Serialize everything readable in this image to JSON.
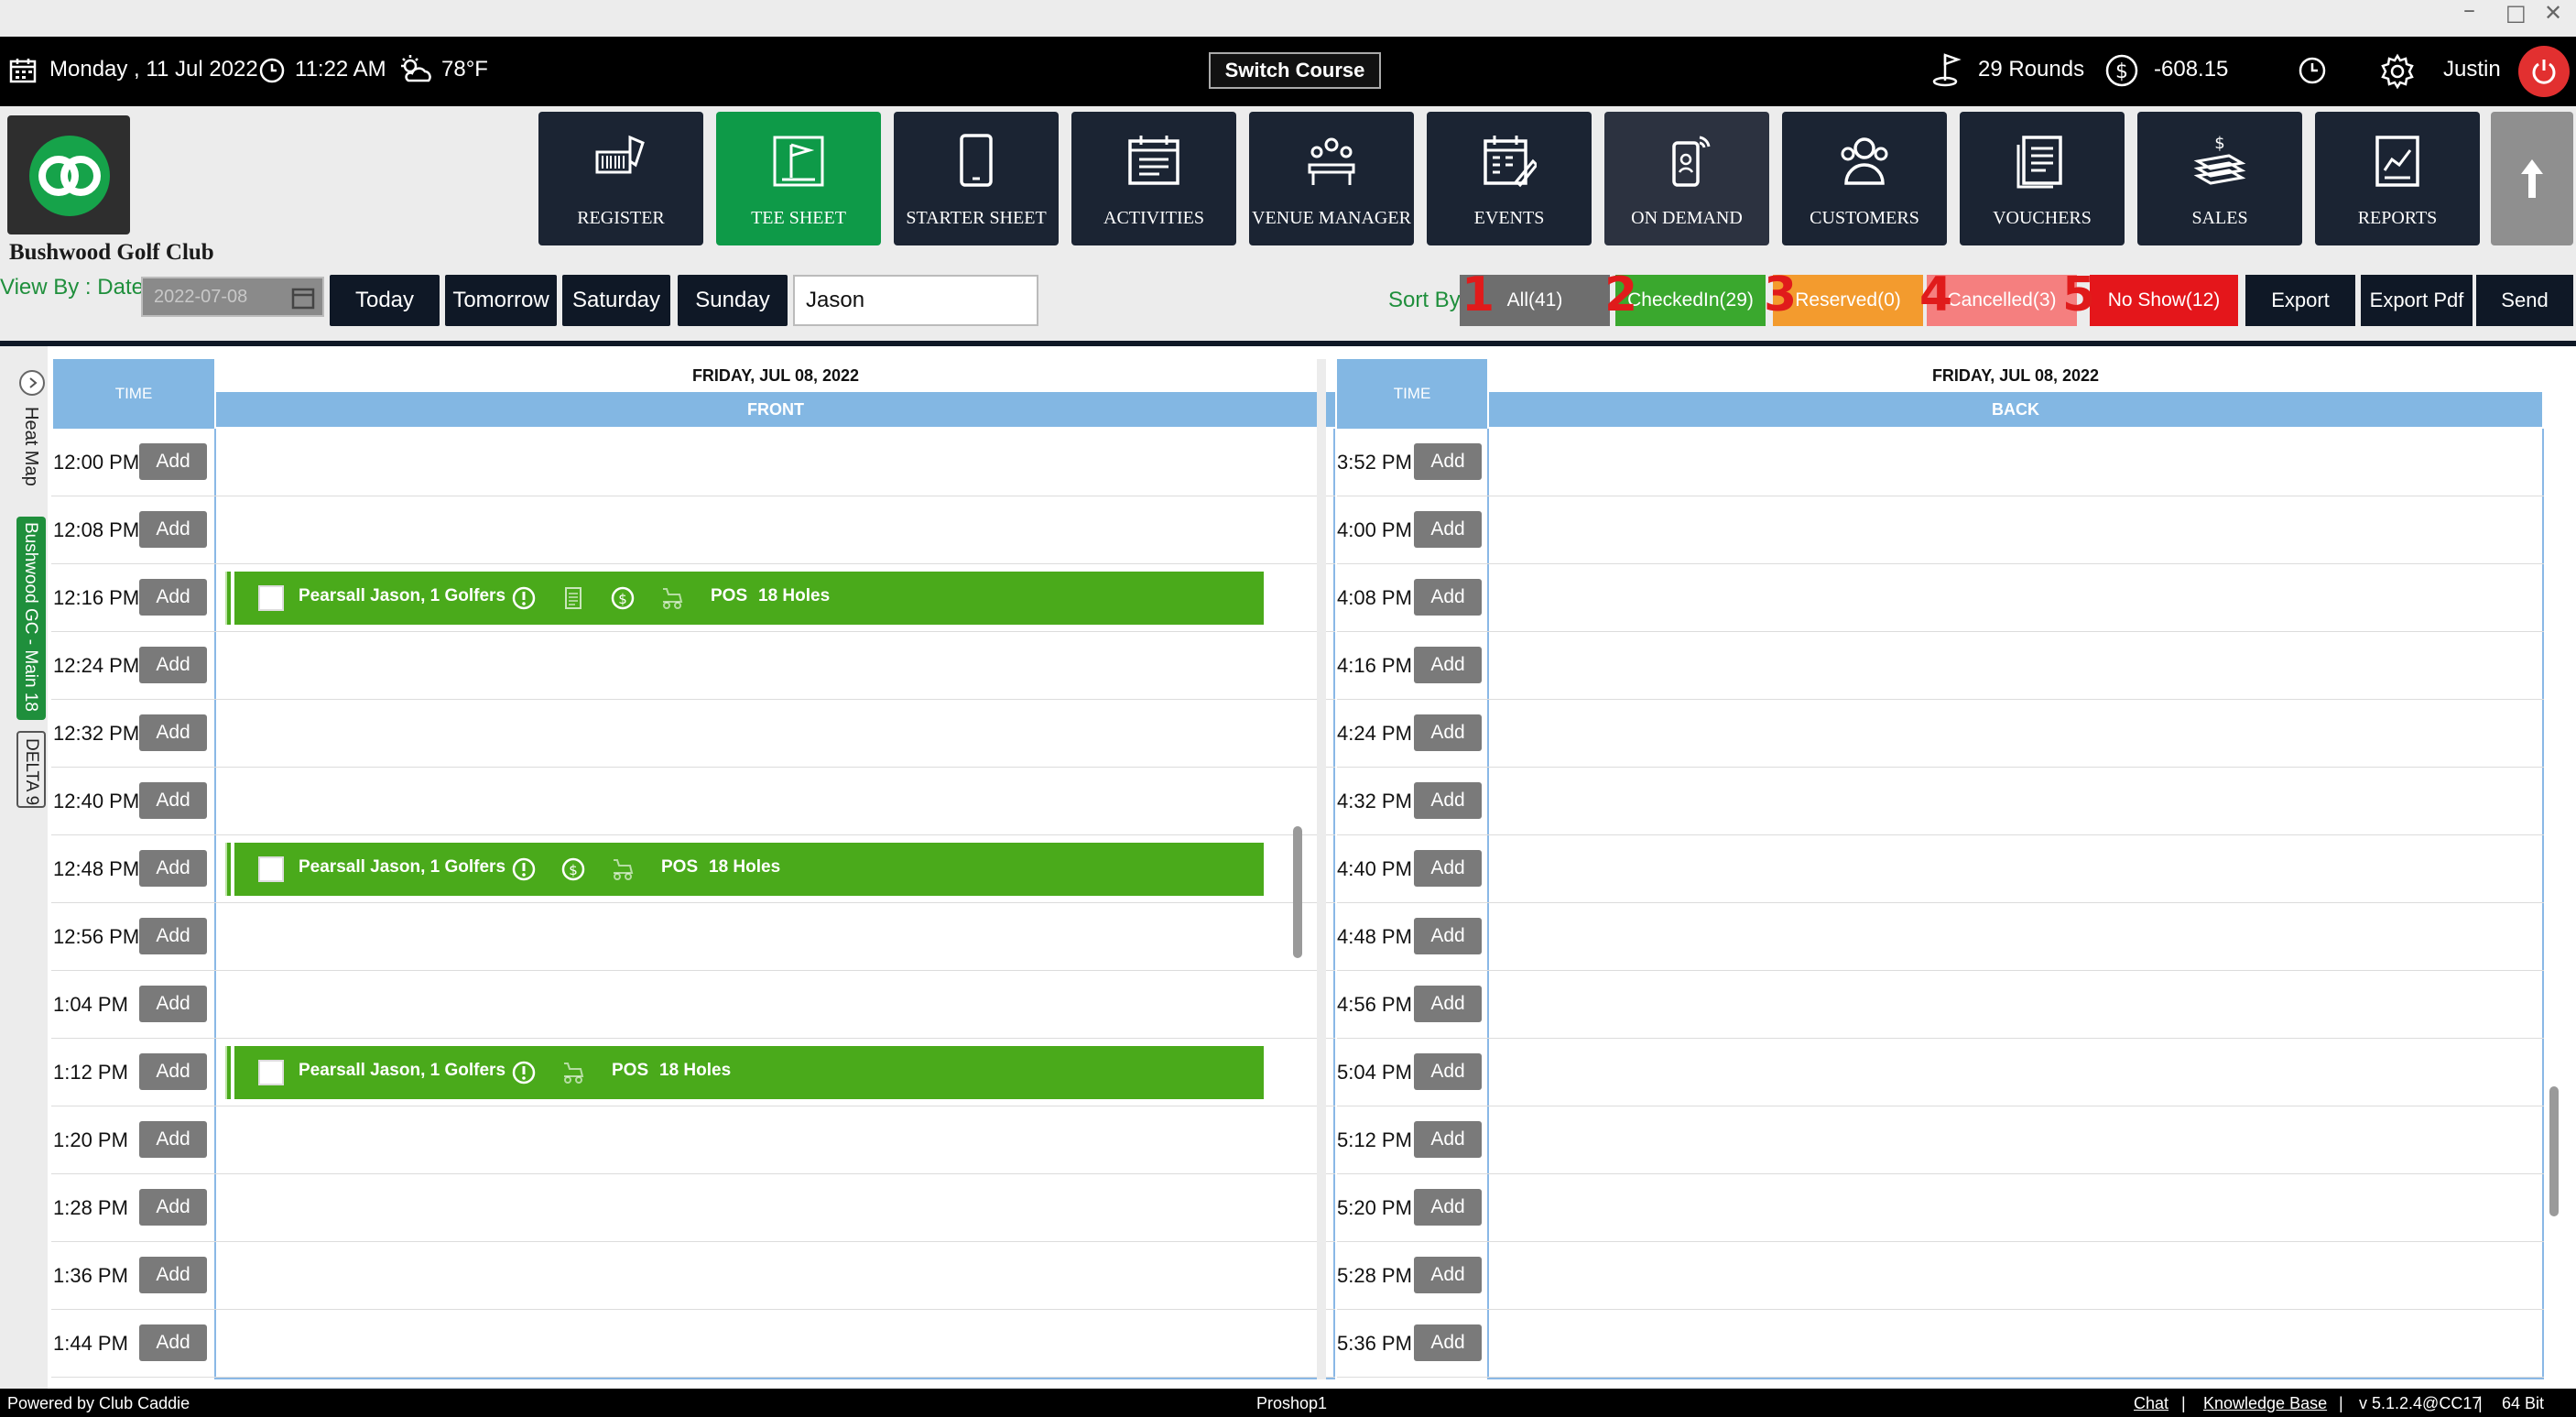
{
  "window": {
    "minimize": "–",
    "maximize": "□",
    "close": "✕"
  },
  "topbar": {
    "date": "Monday ,  11 Jul 2022",
    "time": "11:22 AM",
    "weather": "78°F",
    "switch_course": "Switch Course",
    "rounds": "29 Rounds",
    "balance": "-608.15",
    "user": "Justin"
  },
  "club": {
    "name": "Bushwood Golf Club"
  },
  "nav": [
    {
      "label": "REGISTER",
      "icon": "barcode-scanner-icon"
    },
    {
      "label": "TEE SHEET",
      "icon": "flag-icon",
      "active": true
    },
    {
      "label": "STARTER SHEET",
      "icon": "tablet-icon"
    },
    {
      "label": "ACTIVITIES",
      "icon": "calendar-list-icon"
    },
    {
      "label": "VENUE MANAGER",
      "icon": "meeting-icon"
    },
    {
      "label": "EVENTS",
      "icon": "calendar-edit-icon"
    },
    {
      "label": "ON DEMAND",
      "icon": "mobile-signal-icon"
    },
    {
      "label": "CUSTOMERS",
      "icon": "users-icon"
    },
    {
      "label": "VOUCHERS",
      "icon": "document-icon"
    },
    {
      "label": "SALES",
      "icon": "money-stack-icon"
    },
    {
      "label": "REPORTS",
      "icon": "report-chart-icon"
    }
  ],
  "toolbar": {
    "view_by": "View By : Date",
    "date_value": "2022-07-08",
    "days": [
      "Today",
      "Tomorrow",
      "Saturday",
      "Sunday"
    ],
    "search_value": "Jason",
    "sort_by": "Sort By",
    "sort": [
      {
        "num": "1",
        "label": "All(41)",
        "color": "#6e6e6e"
      },
      {
        "num": "2",
        "label": "CheckedIn(29)",
        "color": "#3aa82e"
      },
      {
        "num": "3",
        "label": "Reserved(0)",
        "color": "#f39b2e"
      },
      {
        "num": "4",
        "label": "Cancelled(3)",
        "color": "#f57f7f"
      },
      {
        "num": "5",
        "label": "No Show(12)",
        "color": "#e4161b"
      }
    ],
    "exports": [
      "Export Excel",
      "Export Pdf",
      "Send Email"
    ]
  },
  "sidebar": {
    "heat_map": "Heat Map",
    "course": "Bushwood GC - Main 18",
    "delta": "DELTA 9"
  },
  "front": {
    "time_header": "TIME",
    "date": "FRIDAY, JUL 08, 2022",
    "section": "FRONT",
    "add_label": "Add",
    "times": [
      "12:00 PM",
      "12:08 PM",
      "12:16 PM",
      "12:24 PM",
      "12:32 PM",
      "12:40 PM",
      "12:48 PM",
      "12:56 PM",
      "1:04 PM",
      "1:12 PM",
      "1:20 PM",
      "1:28 PM",
      "1:36 PM",
      "1:44 PM"
    ],
    "bookings": [
      {
        "row": 2,
        "name": "Pearsall Jason, 1 Golfers",
        "pos": "POS",
        "holes": "18 Holes",
        "icons": [
          "alert-icon",
          "notes-icon",
          "dollar-icon",
          "golf-cart-icon"
        ]
      },
      {
        "row": 6,
        "name": "Pearsall Jason, 1 Golfers",
        "pos": "POS",
        "holes": "18 Holes",
        "icons": [
          "alert-icon",
          "dollar-icon",
          "golf-cart-icon"
        ]
      },
      {
        "row": 9,
        "name": "Pearsall Jason, 1 Golfers",
        "pos": "POS",
        "holes": "18 Holes",
        "icons": [
          "alert-icon",
          "golf-cart-icon"
        ]
      }
    ]
  },
  "back": {
    "time_header": "TIME",
    "date": "FRIDAY, JUL 08, 2022",
    "section": "BACK",
    "add_label": "Add",
    "times": [
      "3:52 PM",
      "4:00 PM",
      "4:08 PM",
      "4:16 PM",
      "4:24 PM",
      "4:32 PM",
      "4:40 PM",
      "4:48 PM",
      "4:56 PM",
      "5:04 PM",
      "5:12 PM",
      "5:20 PM",
      "5:28 PM",
      "5:36 PM"
    ]
  },
  "footer": {
    "powered": "Powered by Club Caddie",
    "station": "Proshop1",
    "chat": "Chat",
    "sep": "|",
    "kb": "Knowledge Base",
    "version": "v 5.1.2.4@CC17",
    "bits": "64 Bit"
  }
}
